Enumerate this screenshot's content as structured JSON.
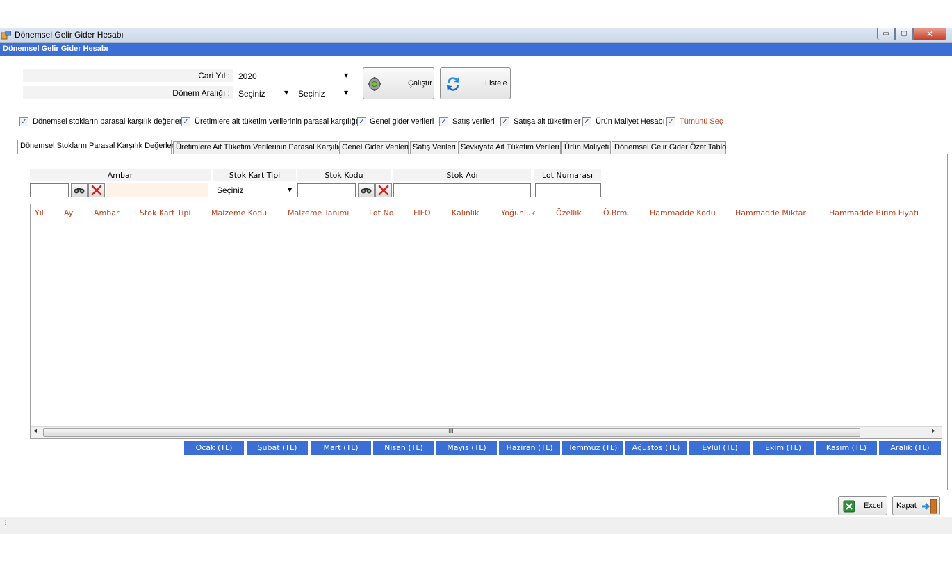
{
  "window": {
    "title": "Dönemsel Gelir Gider Hesabı",
    "header_title": "Dönemsel Gelir Gider Hesabı",
    "minimize_glyph": "▭",
    "maximize_glyph": "▢",
    "close_glyph": "✕"
  },
  "filters": {
    "cari_yil_label": "Cari Yıl :",
    "cari_yil_value": "2020",
    "donem_araligi_label": "Dönem Aralığı :",
    "donem_start_value": "Seçiniz",
    "donem_end_value": "Seçiniz"
  },
  "buttons": {
    "calistir_label": "Çalıştır",
    "listele_label": "Listele",
    "excel_label": "Excel",
    "kapat_label": "Kapat"
  },
  "checkboxes": [
    {
      "label": "Dönemsel stokların parasal karşılık değerleri",
      "checked": true
    },
    {
      "label": "Üretimlere ait tüketim verilerinin parasal karşılığı",
      "checked": true
    },
    {
      "label": "Genel gider verileri",
      "checked": true
    },
    {
      "label": "Satış verileri",
      "checked": true
    },
    {
      "label": "Satışa ait tüketimler",
      "checked": true
    },
    {
      "label": "Ürün Maliyet Hesabı",
      "checked": true
    },
    {
      "label": "Tümünü Seç",
      "checked": true
    }
  ],
  "tabs": [
    {
      "label": "Dönemsel Stokların Parasal Karşılık Değerleri",
      "active": true
    },
    {
      "label": "Üretimlere Ait Tüketim Verilerinin Parasal Karşılığı",
      "active": false
    },
    {
      "label": "Genel Gider Verileri",
      "active": false
    },
    {
      "label": "Satış Verileri",
      "active": false
    },
    {
      "label": "Sevkiyata Ait Tüketim Verileri",
      "active": false
    },
    {
      "label": "Ürün Maliyeti",
      "active": false
    },
    {
      "label": "Dönemsel Gelir Gider Özet Tablo",
      "active": false
    }
  ],
  "search": {
    "ambar_label": "Ambar",
    "stok_kart_tipi_label": "Stok Kart Tipi",
    "stok_kart_tipi_value": "Seçiniz",
    "stok_kodu_label": "Stok Kodu",
    "stok_adi_label": "Stok Adı",
    "lot_numarasi_label": "Lot Numarası"
  },
  "grid": {
    "columns": [
      "Yıl",
      "Ay",
      "Ambar",
      "Stok Kart Tipi",
      "Malzeme Kodu",
      "Malzeme Tanımı",
      "Lot No",
      "FIFO",
      "Kalınlık",
      "Yoğunluk",
      "Özellik",
      "Ö.Brm.",
      "Hammadde Kodu",
      "Hammadde Miktarı",
      "Hammadde Birim Fiyatı"
    ],
    "scroll_grip": "III",
    "scroll_left": "◂",
    "scroll_right": "▸"
  },
  "months": [
    "Ocak (TL)",
    "Şubat (TL)",
    "Mart (TL)",
    "Nisan (TL)",
    "Mayıs (TL)",
    "Haziran (TL)",
    "Temmuz (TL)",
    "Ağustos (TL)",
    "Eylül (TL)",
    "Ekim (TL)",
    "Kasım (TL)",
    "Aralık (TL)"
  ],
  "colors": {
    "accent_blue": "#3b6fd6",
    "column_header_text": "#c0411d",
    "select_all_text": "#c0411d"
  }
}
